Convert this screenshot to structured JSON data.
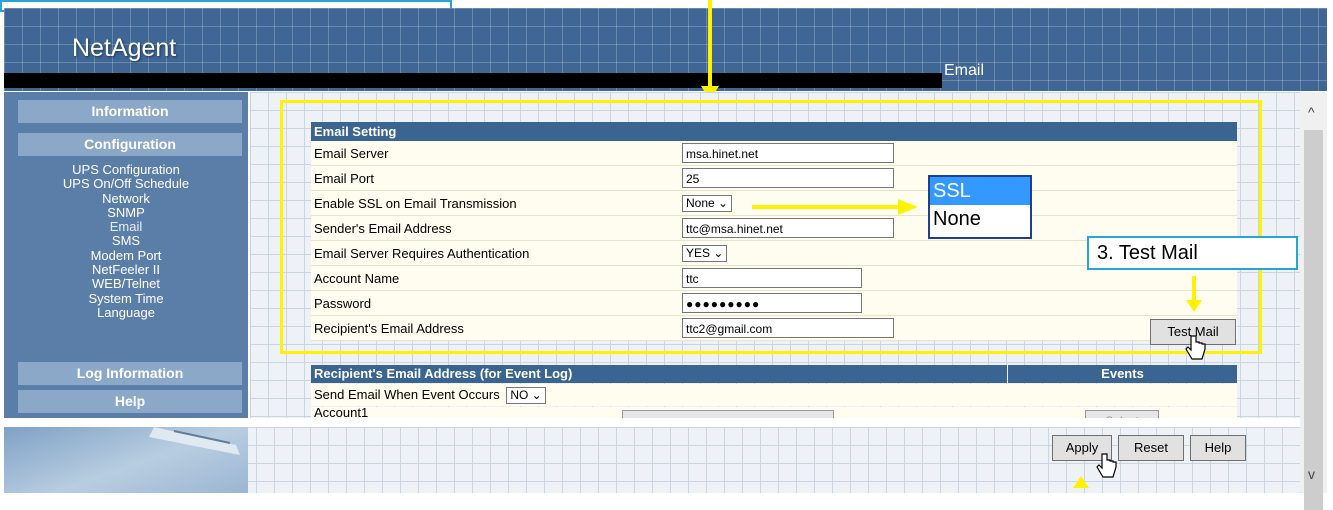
{
  "header": {
    "logo": "NetAgent",
    "title": "Email"
  },
  "sidebar": {
    "sections": [
      "Information",
      "Configuration",
      "Log Information",
      "Help"
    ],
    "links": [
      {
        "label": "UPS Configuration",
        "active": false
      },
      {
        "label": "UPS On/Off Schedule",
        "active": false
      },
      {
        "label": "Network",
        "active": false
      },
      {
        "label": "SNMP",
        "active": false
      },
      {
        "label": "Email",
        "active": true
      },
      {
        "label": "SMS",
        "active": false
      },
      {
        "label": "Modem Port",
        "active": false
      },
      {
        "label": "NetFeeler II",
        "active": false
      },
      {
        "label": "WEB/Telnet",
        "active": false
      },
      {
        "label": "System Time",
        "active": false
      },
      {
        "label": "Language",
        "active": false
      }
    ]
  },
  "email_setting": {
    "heading": "Email Setting",
    "rows": [
      {
        "label": "Email Server",
        "value": "msa.hinet.net"
      },
      {
        "label": "Email Port",
        "value": "25"
      },
      {
        "label": "Enable SSL on Email Transmission",
        "value": "None"
      },
      {
        "label": "Sender's Email Address",
        "value": "ttc@msa.hinet.net"
      },
      {
        "label": "Email Server Requires Authentication",
        "value": "YES"
      },
      {
        "label": "Account Name",
        "value": "ttc"
      },
      {
        "label": "Password",
        "value": "●●●●●●●●●"
      },
      {
        "label": "Recipient's Email Address",
        "value": "ttc2@gmail.com"
      }
    ],
    "test_mail_button": "Test Mail"
  },
  "event_log": {
    "heading": "Recipient's Email Address (for Event Log)",
    "events_heading": "Events",
    "send_label": "Send Email When Event Occurs",
    "send_value": "NO",
    "account_label": "Account1",
    "select_button": "Select"
  },
  "ssl_popup": {
    "options": [
      "SSL",
      "None"
    ],
    "selected": "SSL"
  },
  "annotation": {
    "test_mail": "3. Test Mail"
  },
  "footer": {
    "apply": "Apply",
    "reset": "Reset",
    "help": "Help"
  },
  "colors": {
    "header_blue": "#3f6694",
    "sidebar_blue": "#5b7ea8",
    "highlight_yellow": "#fff200",
    "callout_border": "#27a4d9"
  }
}
